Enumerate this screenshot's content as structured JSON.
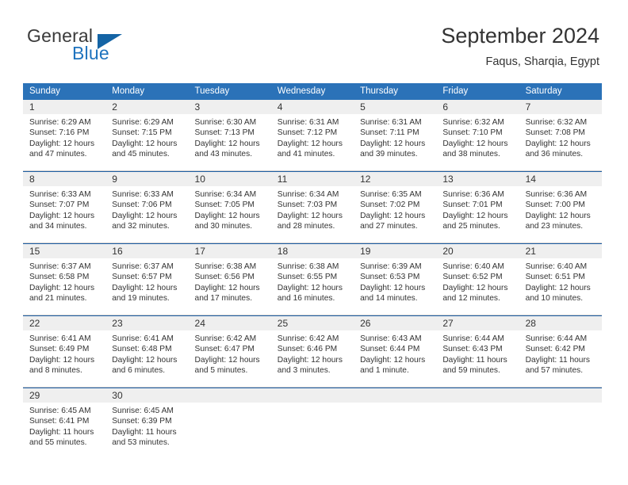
{
  "logo": {
    "word_one": "General",
    "word_two": "Blue",
    "triangle": "blue-triangle-icon",
    "color_dark": "#3a3a3a",
    "color_blue": "#1e73be"
  },
  "header": {
    "title": "September 2024",
    "location": "Faqus, Sharqia, Egypt"
  },
  "theme": {
    "header_bg": "#2b72b8",
    "header_text": "#ffffff",
    "daynum_bg": "#efefef",
    "row_rule": "#1f5fa4",
    "cell_rule": "#cfcfcf"
  },
  "weekdays": [
    "Sunday",
    "Monday",
    "Tuesday",
    "Wednesday",
    "Thursday",
    "Friday",
    "Saturday"
  ],
  "labels": {
    "sunrise": "Sunrise:",
    "sunset": "Sunset:",
    "daylight": "Daylight:"
  },
  "weeks": [
    {
      "days": [
        {
          "num": "1",
          "sunrise": "Sunrise: 6:29 AM",
          "sunset": "Sunset: 7:16 PM",
          "daylight_1": "Daylight: 12 hours",
          "daylight_2": "and 47 minutes."
        },
        {
          "num": "2",
          "sunrise": "Sunrise: 6:29 AM",
          "sunset": "Sunset: 7:15 PM",
          "daylight_1": "Daylight: 12 hours",
          "daylight_2": "and 45 minutes."
        },
        {
          "num": "3",
          "sunrise": "Sunrise: 6:30 AM",
          "sunset": "Sunset: 7:13 PM",
          "daylight_1": "Daylight: 12 hours",
          "daylight_2": "and 43 minutes."
        },
        {
          "num": "4",
          "sunrise": "Sunrise: 6:31 AM",
          "sunset": "Sunset: 7:12 PM",
          "daylight_1": "Daylight: 12 hours",
          "daylight_2": "and 41 minutes."
        },
        {
          "num": "5",
          "sunrise": "Sunrise: 6:31 AM",
          "sunset": "Sunset: 7:11 PM",
          "daylight_1": "Daylight: 12 hours",
          "daylight_2": "and 39 minutes."
        },
        {
          "num": "6",
          "sunrise": "Sunrise: 6:32 AM",
          "sunset": "Sunset: 7:10 PM",
          "daylight_1": "Daylight: 12 hours",
          "daylight_2": "and 38 minutes."
        },
        {
          "num": "7",
          "sunrise": "Sunrise: 6:32 AM",
          "sunset": "Sunset: 7:08 PM",
          "daylight_1": "Daylight: 12 hours",
          "daylight_2": "and 36 minutes."
        }
      ]
    },
    {
      "days": [
        {
          "num": "8",
          "sunrise": "Sunrise: 6:33 AM",
          "sunset": "Sunset: 7:07 PM",
          "daylight_1": "Daylight: 12 hours",
          "daylight_2": "and 34 minutes."
        },
        {
          "num": "9",
          "sunrise": "Sunrise: 6:33 AM",
          "sunset": "Sunset: 7:06 PM",
          "daylight_1": "Daylight: 12 hours",
          "daylight_2": "and 32 minutes."
        },
        {
          "num": "10",
          "sunrise": "Sunrise: 6:34 AM",
          "sunset": "Sunset: 7:05 PM",
          "daylight_1": "Daylight: 12 hours",
          "daylight_2": "and 30 minutes."
        },
        {
          "num": "11",
          "sunrise": "Sunrise: 6:34 AM",
          "sunset": "Sunset: 7:03 PM",
          "daylight_1": "Daylight: 12 hours",
          "daylight_2": "and 28 minutes."
        },
        {
          "num": "12",
          "sunrise": "Sunrise: 6:35 AM",
          "sunset": "Sunset: 7:02 PM",
          "daylight_1": "Daylight: 12 hours",
          "daylight_2": "and 27 minutes."
        },
        {
          "num": "13",
          "sunrise": "Sunrise: 6:36 AM",
          "sunset": "Sunset: 7:01 PM",
          "daylight_1": "Daylight: 12 hours",
          "daylight_2": "and 25 minutes."
        },
        {
          "num": "14",
          "sunrise": "Sunrise: 6:36 AM",
          "sunset": "Sunset: 7:00 PM",
          "daylight_1": "Daylight: 12 hours",
          "daylight_2": "and 23 minutes."
        }
      ]
    },
    {
      "days": [
        {
          "num": "15",
          "sunrise": "Sunrise: 6:37 AM",
          "sunset": "Sunset: 6:58 PM",
          "daylight_1": "Daylight: 12 hours",
          "daylight_2": "and 21 minutes."
        },
        {
          "num": "16",
          "sunrise": "Sunrise: 6:37 AM",
          "sunset": "Sunset: 6:57 PM",
          "daylight_1": "Daylight: 12 hours",
          "daylight_2": "and 19 minutes."
        },
        {
          "num": "17",
          "sunrise": "Sunrise: 6:38 AM",
          "sunset": "Sunset: 6:56 PM",
          "daylight_1": "Daylight: 12 hours",
          "daylight_2": "and 17 minutes."
        },
        {
          "num": "18",
          "sunrise": "Sunrise: 6:38 AM",
          "sunset": "Sunset: 6:55 PM",
          "daylight_1": "Daylight: 12 hours",
          "daylight_2": "and 16 minutes."
        },
        {
          "num": "19",
          "sunrise": "Sunrise: 6:39 AM",
          "sunset": "Sunset: 6:53 PM",
          "daylight_1": "Daylight: 12 hours",
          "daylight_2": "and 14 minutes."
        },
        {
          "num": "20",
          "sunrise": "Sunrise: 6:40 AM",
          "sunset": "Sunset: 6:52 PM",
          "daylight_1": "Daylight: 12 hours",
          "daylight_2": "and 12 minutes."
        },
        {
          "num": "21",
          "sunrise": "Sunrise: 6:40 AM",
          "sunset": "Sunset: 6:51 PM",
          "daylight_1": "Daylight: 12 hours",
          "daylight_2": "and 10 minutes."
        }
      ]
    },
    {
      "days": [
        {
          "num": "22",
          "sunrise": "Sunrise: 6:41 AM",
          "sunset": "Sunset: 6:49 PM",
          "daylight_1": "Daylight: 12 hours",
          "daylight_2": "and 8 minutes."
        },
        {
          "num": "23",
          "sunrise": "Sunrise: 6:41 AM",
          "sunset": "Sunset: 6:48 PM",
          "daylight_1": "Daylight: 12 hours",
          "daylight_2": "and 6 minutes."
        },
        {
          "num": "24",
          "sunrise": "Sunrise: 6:42 AM",
          "sunset": "Sunset: 6:47 PM",
          "daylight_1": "Daylight: 12 hours",
          "daylight_2": "and 5 minutes."
        },
        {
          "num": "25",
          "sunrise": "Sunrise: 6:42 AM",
          "sunset": "Sunset: 6:46 PM",
          "daylight_1": "Daylight: 12 hours",
          "daylight_2": "and 3 minutes."
        },
        {
          "num": "26",
          "sunrise": "Sunrise: 6:43 AM",
          "sunset": "Sunset: 6:44 PM",
          "daylight_1": "Daylight: 12 hours",
          "daylight_2": "and 1 minute."
        },
        {
          "num": "27",
          "sunrise": "Sunrise: 6:44 AM",
          "sunset": "Sunset: 6:43 PM",
          "daylight_1": "Daylight: 11 hours",
          "daylight_2": "and 59 minutes."
        },
        {
          "num": "28",
          "sunrise": "Sunrise: 6:44 AM",
          "sunset": "Sunset: 6:42 PM",
          "daylight_1": "Daylight: 11 hours",
          "daylight_2": "and 57 minutes."
        }
      ]
    },
    {
      "days": [
        {
          "num": "29",
          "sunrise": "Sunrise: 6:45 AM",
          "sunset": "Sunset: 6:41 PM",
          "daylight_1": "Daylight: 11 hours",
          "daylight_2": "and 55 minutes."
        },
        {
          "num": "30",
          "sunrise": "Sunrise: 6:45 AM",
          "sunset": "Sunset: 6:39 PM",
          "daylight_1": "Daylight: 11 hours",
          "daylight_2": "and 53 minutes."
        },
        {
          "num": "",
          "sunrise": "",
          "sunset": "",
          "daylight_1": "",
          "daylight_2": ""
        },
        {
          "num": "",
          "sunrise": "",
          "sunset": "",
          "daylight_1": "",
          "daylight_2": ""
        },
        {
          "num": "",
          "sunrise": "",
          "sunset": "",
          "daylight_1": "",
          "daylight_2": ""
        },
        {
          "num": "",
          "sunrise": "",
          "sunset": "",
          "daylight_1": "",
          "daylight_2": ""
        },
        {
          "num": "",
          "sunrise": "",
          "sunset": "",
          "daylight_1": "",
          "daylight_2": ""
        }
      ]
    }
  ]
}
